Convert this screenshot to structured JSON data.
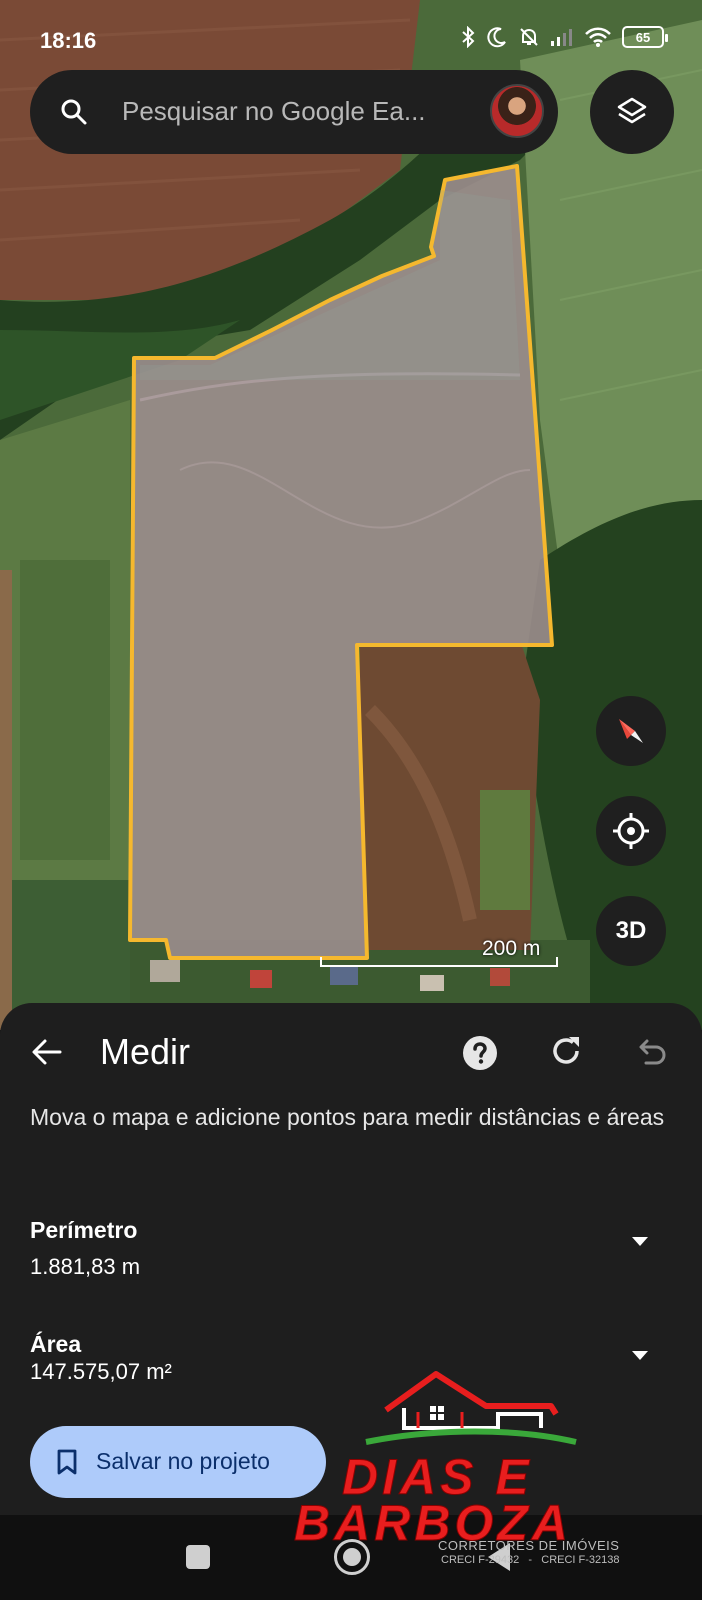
{
  "status_bar": {
    "time": "18:16",
    "battery": "65",
    "icons": [
      "bluetooth-icon",
      "moon-icon",
      "bell-off-icon",
      "signal-icon",
      "wifi-icon",
      "battery-icon"
    ]
  },
  "search": {
    "placeholder": "Pesquisar no Google Ea..."
  },
  "map": {
    "scale_label": "200 m",
    "button_3d": "3D",
    "outline_color": "#f5b82e",
    "buttons": [
      "layers-icon",
      "compass-icon",
      "my-location-icon"
    ]
  },
  "sheet": {
    "title": "Medir",
    "description": "Mova o mapa e adicione pontos para medir distâncias e áreas",
    "perimeter": {
      "label": "Perímetro",
      "value": "1.881,83 m"
    },
    "area": {
      "label": "Área",
      "value": "147.575,07 m²"
    },
    "save_label": "Salvar no projeto",
    "icons": [
      "back-arrow-icon",
      "help-icon",
      "refresh-icon",
      "undo-icon",
      "bookmark-icon"
    ]
  },
  "watermark": {
    "line1": "DIAS E",
    "line2": "BARBOZA",
    "subtitle": "CORRETORES DE IMÓVEIS",
    "creci": "CRECI F-29432   -   CRECI F-32138"
  },
  "colors": {
    "sheet_bg": "#1e1e1e",
    "save_button_bg": "#aecbfa",
    "logo_red": "#e81e1e"
  }
}
